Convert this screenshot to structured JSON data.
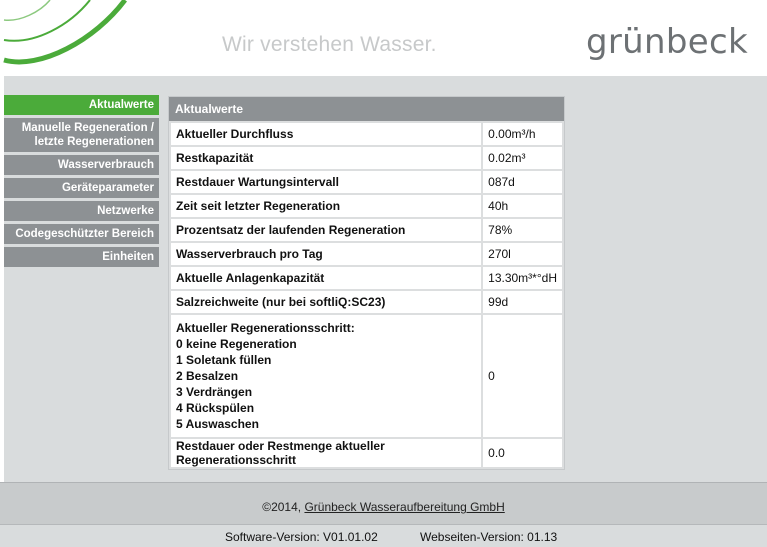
{
  "header": {
    "slogan": "Wir verstehen Wasser.",
    "logo_text": "grünbeck",
    "accent_color": "#4bab3a"
  },
  "sidebar": {
    "items": [
      {
        "label": "Aktualwerte",
        "active": true
      },
      {
        "label": "Manuelle Regeneration / letzte Regenerationen",
        "active": false
      },
      {
        "label": "Wasserverbrauch",
        "active": false
      },
      {
        "label": "Geräteparameter",
        "active": false
      },
      {
        "label": "Netzwerke",
        "active": false
      },
      {
        "label": "Codegeschützter Bereich",
        "active": false
      },
      {
        "label": "Einheiten",
        "active": false
      }
    ]
  },
  "main": {
    "panel_title": "Aktualwerte",
    "rows": [
      {
        "label": "Aktueller Durchfluss",
        "value": "0.00m³/h"
      },
      {
        "label": "Restkapazität",
        "value": "0.02m³"
      },
      {
        "label": "Restdauer Wartungsintervall",
        "value": "087d"
      },
      {
        "label": "Zeit seit letzter Regeneration",
        "value": "40h"
      },
      {
        "label": "Prozentsatz der laufenden Regeneration",
        "value": "78%"
      },
      {
        "label": "Wasserverbrauch pro Tag",
        "value": "270l"
      },
      {
        "label": "Aktuelle Anlagenkapazität",
        "value": "13.30m³*°dH"
      },
      {
        "label": "Salzreichweite (nur bei softliQ:SC23)",
        "value": "99d"
      }
    ],
    "step_row": {
      "lines": [
        "Aktueller Regenerationsschritt:",
        "0 keine Regeneration",
        "1 Soletank füllen",
        "2 Besalzen",
        "3 Verdrängen",
        "4 Rückspülen",
        "5 Auswaschen"
      ],
      "value": "0"
    },
    "last_row": {
      "label": "Restdauer oder Restmenge aktueller Regenerationsschritt",
      "value": "0.0"
    }
  },
  "footer": {
    "copyright_prefix": "©2014, ",
    "company_link": "Grünbeck Wasseraufbereitung GmbH",
    "software_version": "Software-Version: V01.01.02",
    "web_version": "Webseiten-Version: 01.13"
  }
}
